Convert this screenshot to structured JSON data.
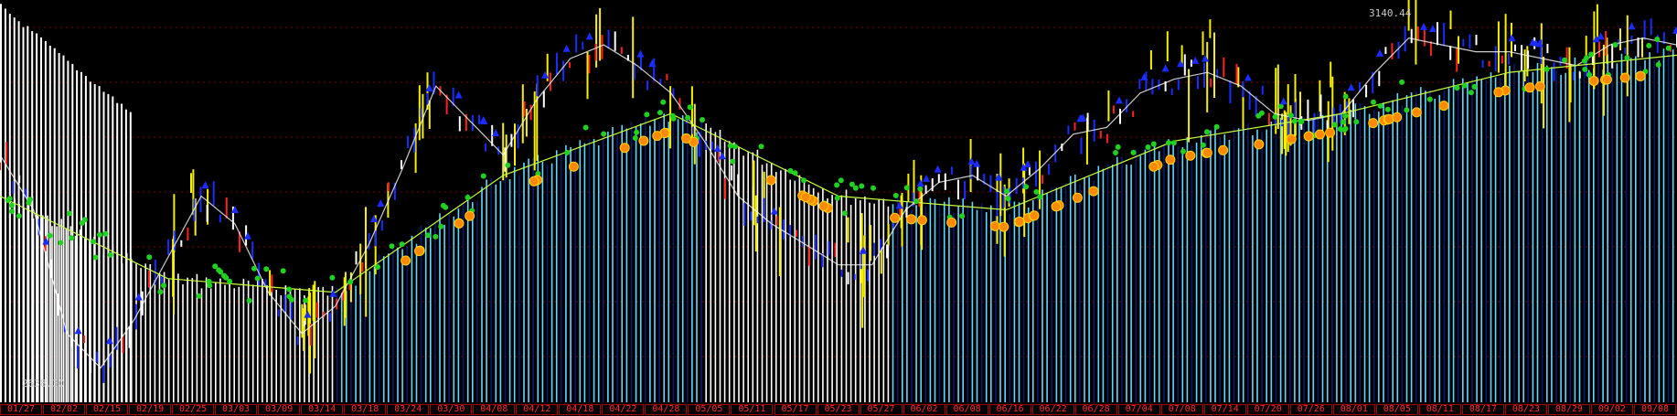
{
  "chart_data": {
    "type": "bar",
    "title": "",
    "xlabel": "",
    "ylabel": "",
    "price_high_label": "3140.44",
    "price_low_label": "2638.30",
    "ylim": [
      2600,
      3180
    ],
    "x_tick_labels": [
      "01/27",
      "02/02",
      "02/15",
      "02/19",
      "02/25",
      "03/03",
      "03/09",
      "03/14",
      "03/18",
      "03/24",
      "03/30",
      "04/08",
      "04/12",
      "04/18",
      "04/22",
      "04/28",
      "05/05",
      "05/11",
      "05/17",
      "05/23",
      "05/27",
      "06/02",
      "06/08",
      "06/16",
      "06/22",
      "06/28",
      "07/04",
      "07/08",
      "07/14",
      "07/20",
      "07/26",
      "08/01",
      "08/05",
      "08/11",
      "08/17",
      "08/23",
      "08/29",
      "09/02",
      "09/08"
    ],
    "price_path": [
      [
        0,
        2960
      ],
      [
        2,
        2880
      ],
      [
        4,
        2700
      ],
      [
        6,
        2650
      ],
      [
        8,
        2720
      ],
      [
        10,
        2810
      ],
      [
        12,
        2900
      ],
      [
        14,
        2860
      ],
      [
        16,
        2760
      ],
      [
        18,
        2700
      ],
      [
        20,
        2740
      ],
      [
        22,
        2830
      ],
      [
        24,
        2940
      ],
      [
        26,
        3060
      ],
      [
        28,
        3010
      ],
      [
        30,
        2960
      ],
      [
        32,
        3040
      ],
      [
        34,
        3100
      ],
      [
        36,
        3120
      ],
      [
        38,
        3090
      ],
      [
        40,
        3050
      ],
      [
        42,
        2980
      ],
      [
        44,
        2900
      ],
      [
        46,
        2860
      ],
      [
        48,
        2830
      ],
      [
        50,
        2800
      ],
      [
        52,
        2800
      ],
      [
        54,
        2880
      ],
      [
        56,
        2920
      ],
      [
        58,
        2930
      ],
      [
        60,
        2900
      ],
      [
        62,
        2940
      ],
      [
        64,
        2990
      ],
      [
        66,
        3000
      ],
      [
        68,
        3050
      ],
      [
        70,
        3070
      ],
      [
        72,
        3080
      ],
      [
        74,
        3060
      ],
      [
        76,
        3020
      ],
      [
        78,
        3010
      ],
      [
        80,
        3020
      ],
      [
        82,
        3080
      ],
      [
        84,
        3130
      ],
      [
        86,
        3120
      ],
      [
        88,
        3110
      ],
      [
        90,
        3110
      ],
      [
        92,
        3100
      ],
      [
        94,
        3090
      ],
      [
        96,
        3120
      ],
      [
        98,
        3130
      ],
      [
        100,
        3120
      ]
    ],
    "ma_curve": [
      [
        0,
        2900
      ],
      [
        10,
        2780
      ],
      [
        20,
        2760
      ],
      [
        30,
        2930
      ],
      [
        40,
        3020
      ],
      [
        50,
        2900
      ],
      [
        60,
        2880
      ],
      [
        70,
        2980
      ],
      [
        80,
        3020
      ],
      [
        90,
        3080
      ],
      [
        100,
        3105
      ]
    ],
    "colors": {
      "background": "#000000",
      "grid": "#7a0000",
      "bar_white": "#ffffff",
      "bar_blue_cyan": "#62d6ff",
      "bar_navy": "#0c1a6e",
      "bar_yellow": "#f5f000",
      "marker_green": "#1fd21f",
      "marker_lime": "#c6ff3c",
      "marker_orange": "#ff8a00",
      "marker_blue": "#1a2cff",
      "line_red": "#ff2020",
      "date_text": "#ff2a2a"
    }
  }
}
